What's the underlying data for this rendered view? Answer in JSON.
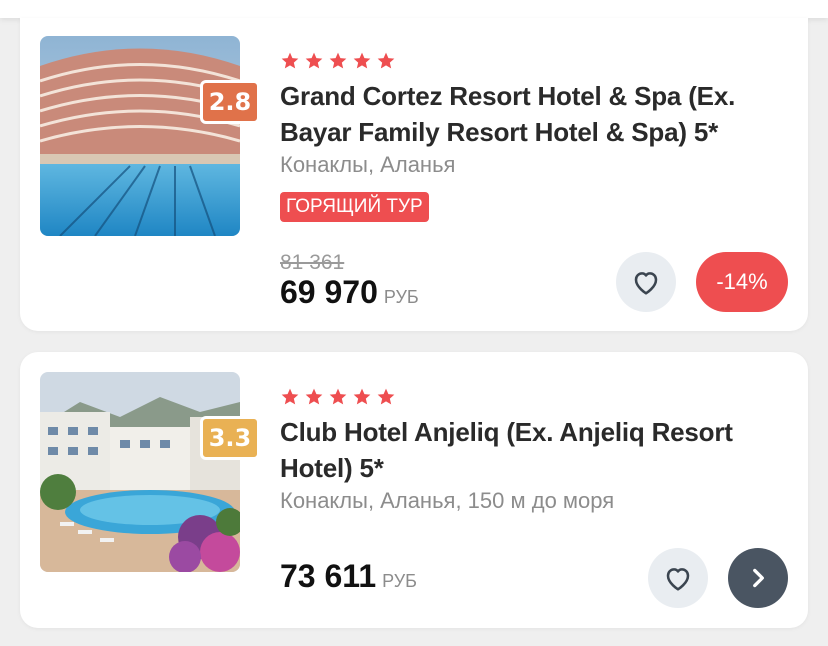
{
  "hotels": [
    {
      "rating": "2.8",
      "stars": 5,
      "name": "Grand Cortez Resort Hotel & Spa (Ex. Bayar Family Resort Hotel & Spa) 5*",
      "location": "Конаклы, Аланья",
      "badge": "ГОРЯЩИЙ ТУР",
      "old_price": "81 361",
      "price": "69 970",
      "currency": "РУБ",
      "discount": "-14%"
    },
    {
      "rating": "3.3",
      "stars": 5,
      "name": "Club Hotel Anjeliq (Ex. Anjeliq Resort Hotel) 5*",
      "location": "Конаклы, Аланья, 150 м до моря",
      "price": "73 611",
      "currency": "РУБ"
    }
  ],
  "icons": {
    "star": "star-icon",
    "favorite": "heart-icon",
    "next": "chevron-right-icon"
  },
  "colors": {
    "accent_red": "#ee4e50",
    "star": "#ee4e50",
    "rating_low": "#e0724a",
    "rating_mid": "#e9b154",
    "next_button": "#4a5562"
  }
}
